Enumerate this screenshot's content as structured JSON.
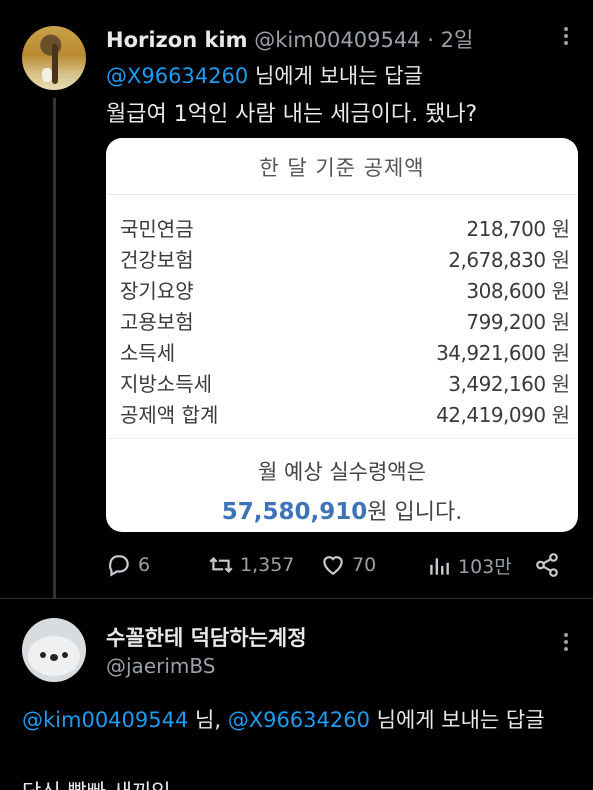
{
  "tweet1": {
    "author_name": "Horizon kim",
    "handle": "@kim00409544",
    "dot": "·",
    "time": "2일",
    "reply_mention": "@X96634260",
    "reply_suffix": " 님에게 보내는 답글",
    "text": "월급여 1억인 사람 내는 세금이다. 됐나?",
    "card": {
      "title": "한 달 기준 공제액",
      "unit": "원",
      "rows": [
        {
          "label": "국민연금",
          "amount": "218,700"
        },
        {
          "label": "건강보험",
          "amount": "2,678,830"
        },
        {
          "label": "장기요양",
          "amount": "308,600"
        },
        {
          "label": "고용보험",
          "amount": "799,200"
        },
        {
          "label": "소득세",
          "amount": "34,921,600"
        },
        {
          "label": "지방소득세",
          "amount": "3,492,160"
        },
        {
          "label": "공제액 합계",
          "amount": "42,419,090"
        }
      ],
      "summary_label": "월 예상 실수령액은",
      "summary_amount": "57,580,910",
      "summary_suffix": "원 입니다."
    },
    "actions": {
      "replies": "6",
      "retweets": "1,357",
      "likes": "70",
      "views": "103만"
    }
  },
  "tweet2": {
    "author_name": "수꼴한테 덕담하는계정",
    "handle": "@jaerimBS",
    "reply_mention1": "@kim00409544",
    "reply_mid": " 님, ",
    "reply_mention2": "@X96634260",
    "reply_suffix": " 님에게 보내는 답글",
    "text": "당신 빨빠 새끼임"
  },
  "colors": {
    "background": "#000000",
    "mention": "#1d9bf0",
    "muted": "#9aa0a6",
    "highlight_amount": "#3f73b8"
  }
}
